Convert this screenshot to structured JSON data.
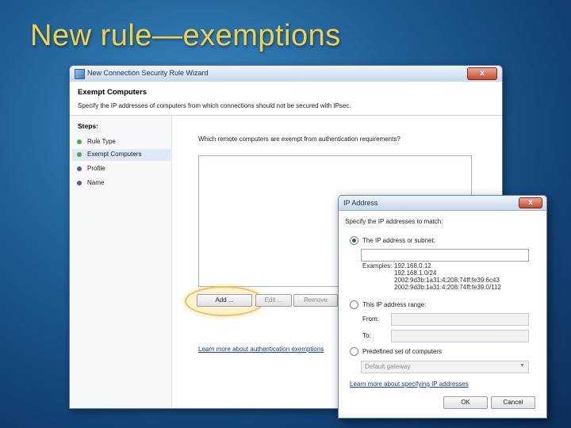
{
  "slide": {
    "title": "New rule—exemptions"
  },
  "wizard": {
    "window_title": "New Connection Security Rule Wizard",
    "close_glyph": "x",
    "banner_title": "Exempt Computers",
    "banner_desc": "Specify the IP addresses of computers from which connections should not be secured with IPsec.",
    "steps_title": "Steps:",
    "steps": [
      {
        "label": "Rule Type",
        "status_color": "#4cae3c"
      },
      {
        "label": "Exempt Computers",
        "status_color": "#4cae3c"
      },
      {
        "label": "Profile",
        "status_color": "#4f5fae"
      },
      {
        "label": "Name",
        "status_color": "#4f5fae"
      }
    ],
    "question": "Which remote computers are exempt from authentication requirements?",
    "buttons": {
      "add": "Add ...",
      "edit": "Edit ...",
      "remove": "Remove"
    },
    "learn_more": "Learn more about authentication exemptions"
  },
  "ip_dialog": {
    "title": "IP Address",
    "close_glyph": "x",
    "instruction": "Specify the IP addresses to match:",
    "option_subnet": "The IP address or subnet:",
    "examples_label": "Examples:",
    "examples": [
      "192.168.0.12",
      "192.168.1.0/24",
      "2002:9d3b:1a31:4:208:74ff:fe39:6c43",
      "2002:9d3b:1a31:4:208:74ff:fe39:0/112"
    ],
    "option_range": "This IP address range:",
    "from_label": "From:",
    "to_label": "To:",
    "option_predefined": "Predefined set of computers",
    "predefined_value": "Default gateway",
    "learn_more": "Learn more about specifying IP addresses",
    "ok": "OK",
    "cancel": "Cancel"
  },
  "colors": {
    "title": "#f0d24a",
    "highlight": "#f1c25a"
  }
}
